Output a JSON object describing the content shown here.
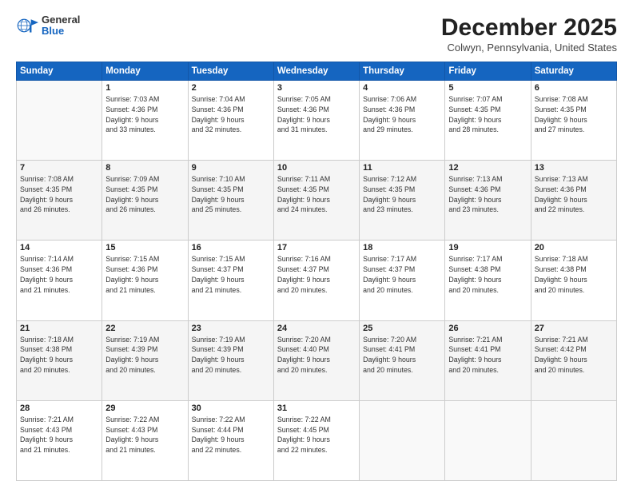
{
  "header": {
    "logo_general": "General",
    "logo_blue": "Blue",
    "month_title": "December 2025",
    "location": "Colwyn, Pennsylvania, United States"
  },
  "days_of_week": [
    "Sunday",
    "Monday",
    "Tuesday",
    "Wednesday",
    "Thursday",
    "Friday",
    "Saturday"
  ],
  "weeks": [
    [
      {
        "day": "",
        "sunrise": "",
        "sunset": "",
        "daylight": ""
      },
      {
        "day": "1",
        "sunrise": "7:03 AM",
        "sunset": "4:36 PM",
        "hours": "9 hours",
        "minutes": "and 33 minutes."
      },
      {
        "day": "2",
        "sunrise": "7:04 AM",
        "sunset": "4:36 PM",
        "hours": "9 hours",
        "minutes": "and 32 minutes."
      },
      {
        "day": "3",
        "sunrise": "7:05 AM",
        "sunset": "4:36 PM",
        "hours": "9 hours",
        "minutes": "and 31 minutes."
      },
      {
        "day": "4",
        "sunrise": "7:06 AM",
        "sunset": "4:36 PM",
        "hours": "9 hours",
        "minutes": "and 29 minutes."
      },
      {
        "day": "5",
        "sunrise": "7:07 AM",
        "sunset": "4:35 PM",
        "hours": "9 hours",
        "minutes": "and 28 minutes."
      },
      {
        "day": "6",
        "sunrise": "7:08 AM",
        "sunset": "4:35 PM",
        "hours": "9 hours",
        "minutes": "and 27 minutes."
      }
    ],
    [
      {
        "day": "7",
        "sunrise": "7:08 AM",
        "sunset": "4:35 PM",
        "hours": "9 hours",
        "minutes": "and 26 minutes."
      },
      {
        "day": "8",
        "sunrise": "7:09 AM",
        "sunset": "4:35 PM",
        "hours": "9 hours",
        "minutes": "and 26 minutes."
      },
      {
        "day": "9",
        "sunrise": "7:10 AM",
        "sunset": "4:35 PM",
        "hours": "9 hours",
        "minutes": "and 25 minutes."
      },
      {
        "day": "10",
        "sunrise": "7:11 AM",
        "sunset": "4:35 PM",
        "hours": "9 hours",
        "minutes": "and 24 minutes."
      },
      {
        "day": "11",
        "sunrise": "7:12 AM",
        "sunset": "4:35 PM",
        "hours": "9 hours",
        "minutes": "and 23 minutes."
      },
      {
        "day": "12",
        "sunrise": "7:13 AM",
        "sunset": "4:36 PM",
        "hours": "9 hours",
        "minutes": "and 23 minutes."
      },
      {
        "day": "13",
        "sunrise": "7:13 AM",
        "sunset": "4:36 PM",
        "hours": "9 hours",
        "minutes": "and 22 minutes."
      }
    ],
    [
      {
        "day": "14",
        "sunrise": "7:14 AM",
        "sunset": "4:36 PM",
        "hours": "9 hours",
        "minutes": "and 21 minutes."
      },
      {
        "day": "15",
        "sunrise": "7:15 AM",
        "sunset": "4:36 PM",
        "hours": "9 hours",
        "minutes": "and 21 minutes."
      },
      {
        "day": "16",
        "sunrise": "7:15 AM",
        "sunset": "4:37 PM",
        "hours": "9 hours",
        "minutes": "and 21 minutes."
      },
      {
        "day": "17",
        "sunrise": "7:16 AM",
        "sunset": "4:37 PM",
        "hours": "9 hours",
        "minutes": "and 20 minutes."
      },
      {
        "day": "18",
        "sunrise": "7:17 AM",
        "sunset": "4:37 PM",
        "hours": "9 hours",
        "minutes": "and 20 minutes."
      },
      {
        "day": "19",
        "sunrise": "7:17 AM",
        "sunset": "4:38 PM",
        "hours": "9 hours",
        "minutes": "and 20 minutes."
      },
      {
        "day": "20",
        "sunrise": "7:18 AM",
        "sunset": "4:38 PM",
        "hours": "9 hours",
        "minutes": "and 20 minutes."
      }
    ],
    [
      {
        "day": "21",
        "sunrise": "7:18 AM",
        "sunset": "4:38 PM",
        "hours": "9 hours",
        "minutes": "and 20 minutes."
      },
      {
        "day": "22",
        "sunrise": "7:19 AM",
        "sunset": "4:39 PM",
        "hours": "9 hours",
        "minutes": "and 20 minutes."
      },
      {
        "day": "23",
        "sunrise": "7:19 AM",
        "sunset": "4:39 PM",
        "hours": "9 hours",
        "minutes": "and 20 minutes."
      },
      {
        "day": "24",
        "sunrise": "7:20 AM",
        "sunset": "4:40 PM",
        "hours": "9 hours",
        "minutes": "and 20 minutes."
      },
      {
        "day": "25",
        "sunrise": "7:20 AM",
        "sunset": "4:41 PM",
        "hours": "9 hours",
        "minutes": "and 20 minutes."
      },
      {
        "day": "26",
        "sunrise": "7:21 AM",
        "sunset": "4:41 PM",
        "hours": "9 hours",
        "minutes": "and 20 minutes."
      },
      {
        "day": "27",
        "sunrise": "7:21 AM",
        "sunset": "4:42 PM",
        "hours": "9 hours",
        "minutes": "and 20 minutes."
      }
    ],
    [
      {
        "day": "28",
        "sunrise": "7:21 AM",
        "sunset": "4:43 PM",
        "hours": "9 hours",
        "minutes": "and 21 minutes."
      },
      {
        "day": "29",
        "sunrise": "7:22 AM",
        "sunset": "4:43 PM",
        "hours": "9 hours",
        "minutes": "and 21 minutes."
      },
      {
        "day": "30",
        "sunrise": "7:22 AM",
        "sunset": "4:44 PM",
        "hours": "9 hours",
        "minutes": "and 22 minutes."
      },
      {
        "day": "31",
        "sunrise": "7:22 AM",
        "sunset": "4:45 PM",
        "hours": "9 hours",
        "minutes": "and 22 minutes."
      },
      {
        "day": "",
        "sunrise": "",
        "sunset": "",
        "hours": "",
        "minutes": ""
      },
      {
        "day": "",
        "sunrise": "",
        "sunset": "",
        "hours": "",
        "minutes": ""
      },
      {
        "day": "",
        "sunrise": "",
        "sunset": "",
        "hours": "",
        "minutes": ""
      }
    ]
  ],
  "labels": {
    "sunrise": "Sunrise:",
    "sunset": "Sunset:",
    "daylight": "Daylight:"
  }
}
